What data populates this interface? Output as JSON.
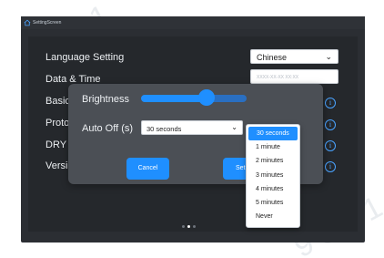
{
  "topbar": {
    "title": "SettingScreen",
    "home_icon": "home-icon"
  },
  "settings": {
    "language_label": "Language Setting",
    "language_value": "Chinese",
    "datetime_label": "Data & Time",
    "datetime_placeholder": "XXXX-XX-XX XX:XX",
    "basic_label": "Basic",
    "proto_label": "Proto",
    "dry_label": "DRY (",
    "version_label": "Versic"
  },
  "dialog": {
    "brightness_label": "Brightness",
    "brightness_level": 0.62,
    "auto_off_label": "Auto Off (s)",
    "auto_off_value": "30 seconds",
    "cancel_label": "Cancel",
    "set_label": "Set"
  },
  "dropdown": {
    "options": [
      "30 seconds",
      "1 minute",
      "2 minutes",
      "3 minutes",
      "4 minutes",
      "5 minutes",
      "Never"
    ],
    "selected_index": 0
  },
  "pager": {
    "count": 3,
    "active_index": 1
  },
  "colors": {
    "accent": "#1f8fff",
    "panel": "#25282c",
    "dialog": "#4b4f55",
    "info": "#4aa3ff"
  }
}
